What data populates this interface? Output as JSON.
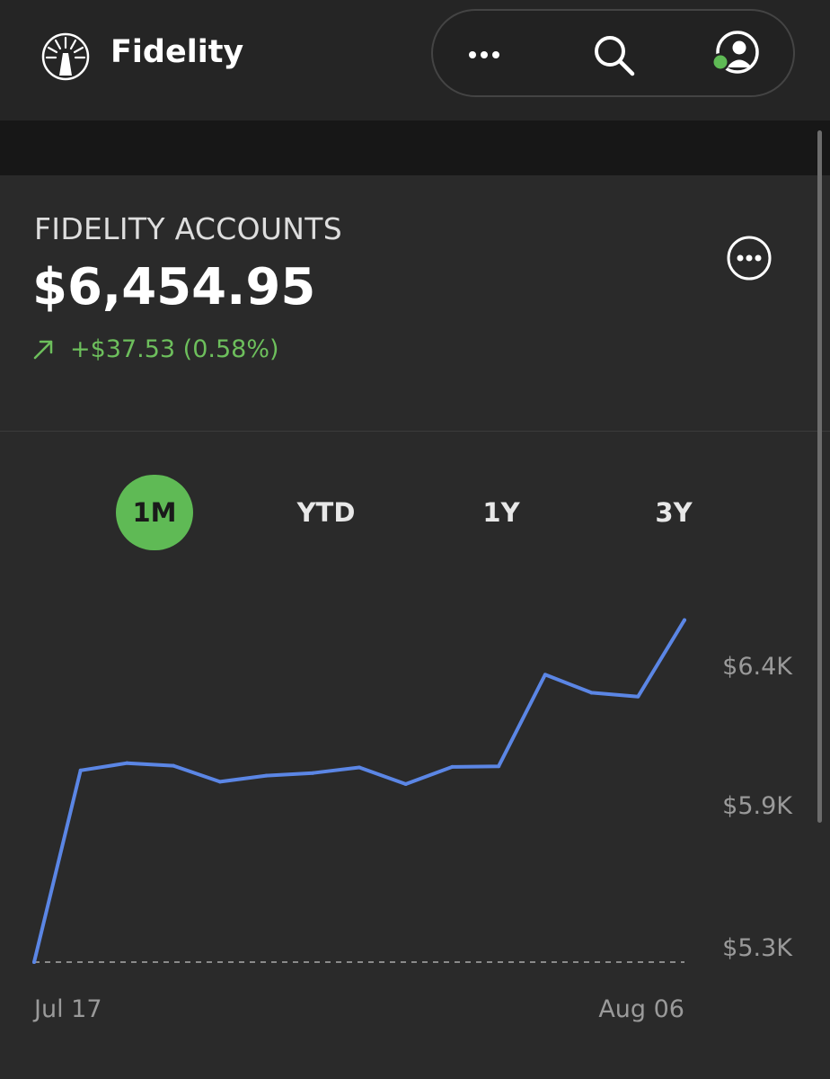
{
  "header": {
    "brand": "Fidelity",
    "icons": [
      "fidelity-logo-icon",
      "more-icon",
      "search-icon",
      "profile-icon"
    ],
    "status_dot_color": "#5fba55"
  },
  "summary": {
    "label": "FIDELITY ACCOUNTS",
    "value": "$6,454.95",
    "change": "+$37.53 (0.58%)",
    "change_color": "#6dbf5c"
  },
  "ranges": {
    "items": [
      "1M",
      "YTD",
      "1Y",
      "3Y"
    ],
    "selected": "1M",
    "active_color": "#5fba55"
  },
  "chart_data": {
    "type": "line",
    "x_labels": [
      "Jul 17",
      "Aug 06"
    ],
    "y_ticks": [
      "$6.4K",
      "$5.9K",
      "$5.3K"
    ],
    "tick_values": [
      6400,
      5900,
      5300
    ],
    "ylim": [
      5300,
      6400
    ],
    "baseline": 5300,
    "line_color": "#5b86e5",
    "series": [
      {
        "values": [
          5300,
          5957,
          5982,
          5973,
          5918,
          5939,
          5948,
          5967,
          5910,
          5969,
          5971,
          6285,
          6223,
          6210,
          6472
        ]
      }
    ]
  }
}
